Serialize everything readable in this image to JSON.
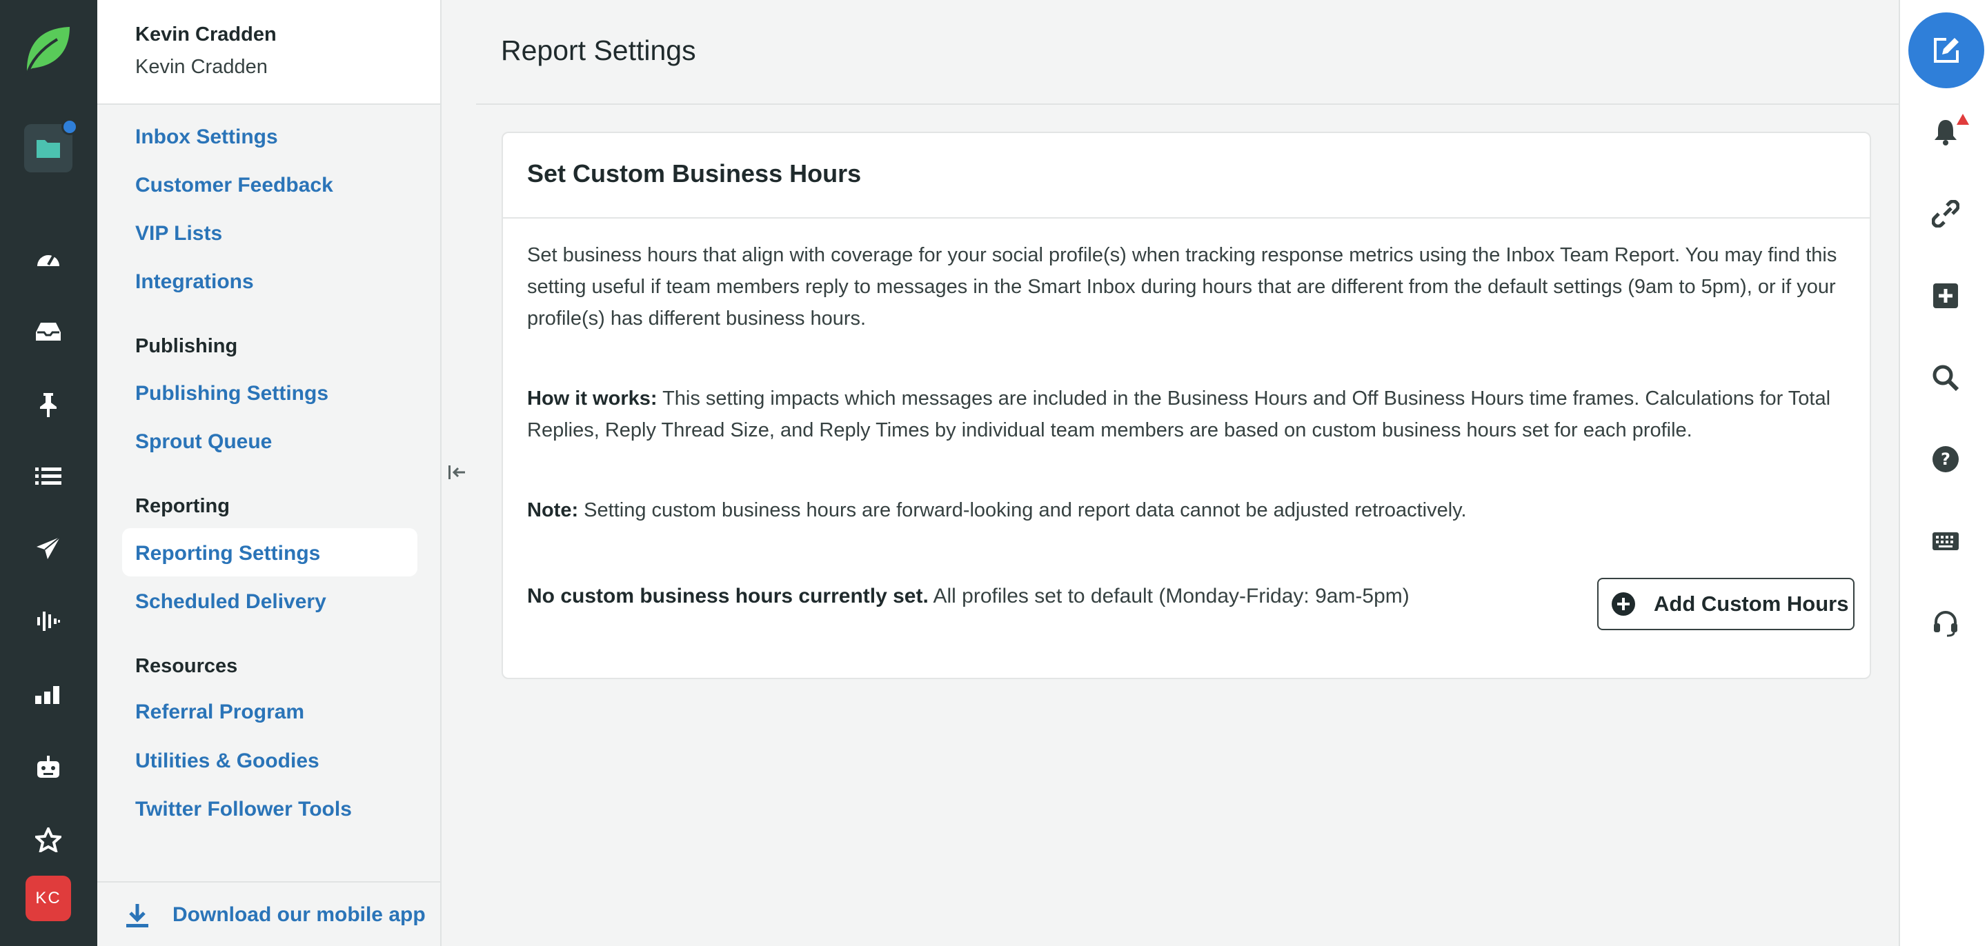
{
  "colors": {
    "rail": "#273234",
    "accent": "#2a74b8",
    "brand_green": "#59cb59",
    "compose": "#2f7fd9",
    "avatar": "#e03c3c"
  },
  "account": {
    "name": "Kevin Cradden",
    "subname": "Kevin Cradden"
  },
  "avatar": {
    "initials": "KC"
  },
  "sidebar": {
    "top_links": [
      "Inbox Settings",
      "Customer Feedback",
      "VIP Lists",
      "Integrations"
    ],
    "sections": [
      {
        "heading": "Publishing",
        "links": [
          "Publishing Settings",
          "Sprout Queue"
        ]
      },
      {
        "heading": "Reporting",
        "links": [
          "Reporting Settings",
          "Scheduled Delivery"
        ],
        "active": "Reporting Settings"
      },
      {
        "heading": "Resources",
        "links": [
          "Referral Program",
          "Utilities & Goodies",
          "Twitter Follower Tools"
        ]
      }
    ],
    "footer": {
      "download_label": "Download our mobile app"
    }
  },
  "rail_icons": [
    "folder-icon",
    "dashboard-icon",
    "inbox-icon",
    "pin-icon",
    "list-icon",
    "send-icon",
    "listening-icon",
    "reports-icon",
    "bot-icon",
    "star-icon"
  ],
  "right_rail_icons": [
    "compose-icon",
    "bell-icon",
    "link-icon",
    "plus-square-icon",
    "search-icon",
    "help-icon",
    "keyboard-icon",
    "headset-icon"
  ],
  "page": {
    "title": "Report Settings",
    "card": {
      "title": "Set Custom Business Hours",
      "intro": "Set business hours that align with coverage for your social profile(s) when tracking response metrics using the Inbox Team Report. You may find this setting useful if team members reply to messages in the Smart Inbox during hours that are different from the default settings (9am to 5pm), or if your profile(s) has different business hours.",
      "how_label": "How it works:",
      "how_text": "This setting impacts which messages are included in the Business Hours and Off Business Hours time frames. Calculations for Total Replies, Reply Thread Size, and Reply Times by individual team members are based on custom business hours set for each profile.",
      "note_label": "Note:",
      "note_text": "Setting custom business hours are forward-looking and report data cannot be adjusted retroactively.",
      "status_bold": "No custom business hours currently set.",
      "status_text": "All profiles set to default (Monday-Friday: 9am-5pm)",
      "add_button": "Add Custom Hours"
    }
  }
}
